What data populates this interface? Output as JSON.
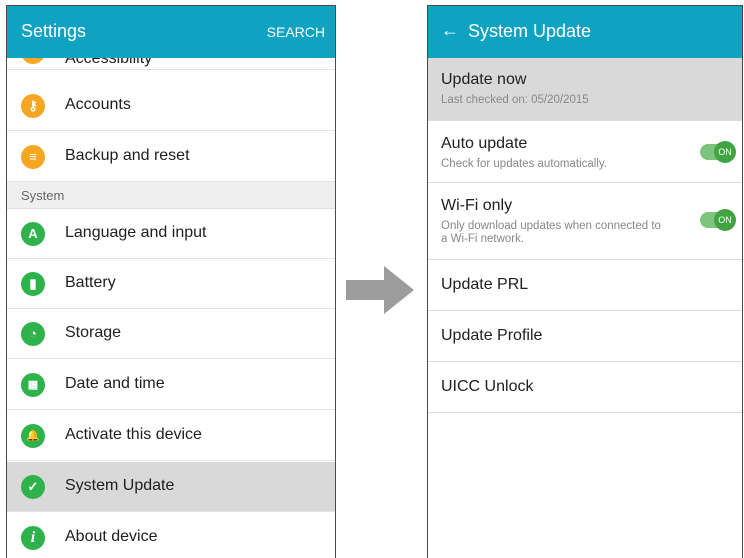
{
  "left": {
    "appbar": {
      "title": "Settings",
      "action": "SEARCH"
    },
    "items_top": [
      {
        "label": "Accessibility",
        "icon": "accessibility-icon",
        "color": "orange"
      },
      {
        "label": "Accounts",
        "icon": "key-icon",
        "color": "orange"
      },
      {
        "label": "Backup and reset",
        "icon": "backup-icon",
        "color": "orange"
      }
    ],
    "section": "System",
    "items": [
      {
        "label": "Language and input",
        "glyph": "A",
        "icon": "language-icon"
      },
      {
        "label": "Battery",
        "glyph": "▮",
        "icon": "battery-icon"
      },
      {
        "label": "Storage",
        "glyph": "◔",
        "icon": "storage-icon"
      },
      {
        "label": "Date and time",
        "glyph": "▦",
        "icon": "calendar-icon"
      },
      {
        "label": "Activate this device",
        "glyph": "🔔",
        "icon": "bell-icon"
      },
      {
        "label": "System Update",
        "glyph": "✓",
        "icon": "check-icon"
      },
      {
        "label": "About device",
        "glyph": "i",
        "icon": "info-icon"
      }
    ]
  },
  "right": {
    "appbar": {
      "title": "System Update",
      "back": "←"
    },
    "update_now": {
      "title": "Update now",
      "sub": "Last checked on: 05/20/2015"
    },
    "auto_update": {
      "title": "Auto update",
      "sub": "Check for updates automatically.",
      "toggle": "ON"
    },
    "wifi_only": {
      "title": "Wi-Fi only",
      "sub_line1": "Only download updates when connected to",
      "sub_line2": "a Wi-Fi network.",
      "toggle": "ON"
    },
    "items": [
      "Update PRL",
      "Update Profile",
      "UICC Unlock"
    ]
  },
  "colors": {
    "appbar": "#0fa3c2",
    "orange_icon": "#f5a623",
    "green_icon": "#2db34a",
    "toggle": "#41a443"
  }
}
